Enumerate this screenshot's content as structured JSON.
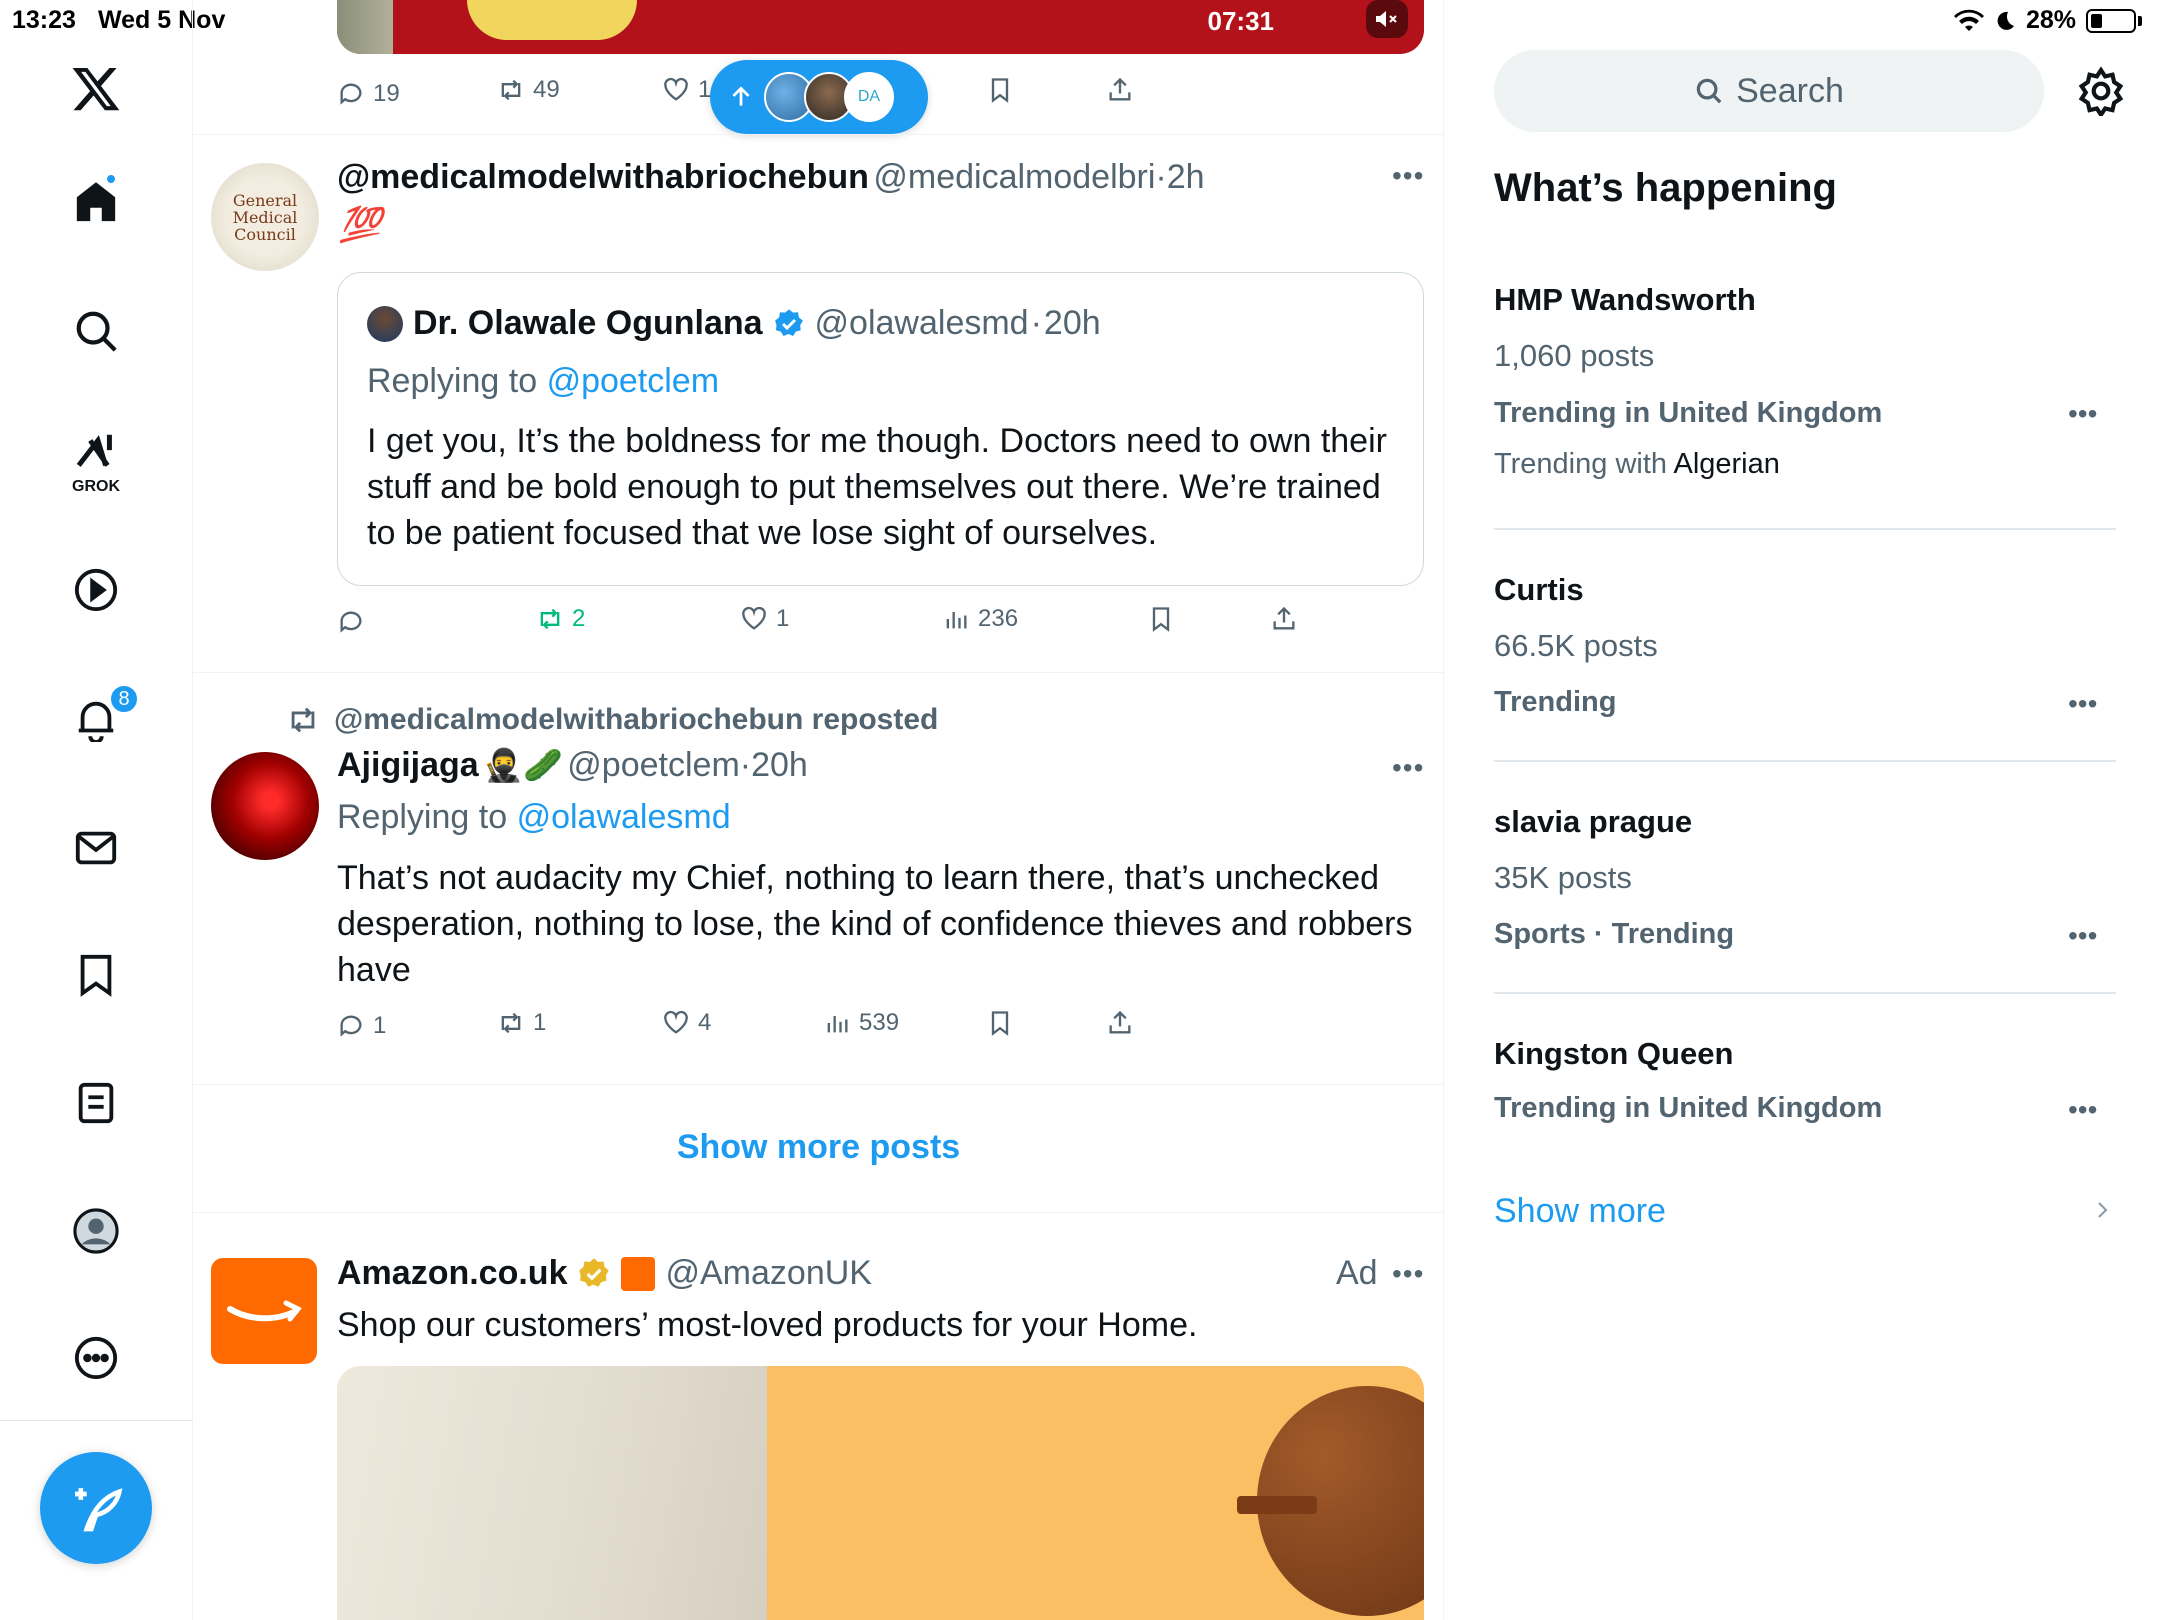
{
  "status": {
    "time": "13:23",
    "date": "Wed 5 Nov",
    "battery": "28%"
  },
  "nav": {
    "grok_label": "GROK",
    "notifications_count": "8"
  },
  "top_post": {
    "video_time": "07:31",
    "replies": "19",
    "reposts": "49",
    "likes": "1"
  },
  "post1": {
    "name": "@medicalmodelwithabriochebun",
    "handle": "@medicalmodelbri",
    "sep": "·",
    "time": "2h",
    "emoji": "💯",
    "avatar_text": "General Medical Council",
    "quote": {
      "name": "Dr. Olawale Ogunlana",
      "handle": "@olawalesmd",
      "sep": "·",
      "time": "20h",
      "replying_prefix": "Replying to",
      "replying_to": "@poetclem",
      "text": "I get you, It’s the boldness for me though. Doctors need to own their stuff and be bold enough to put themselves out there. We’re trained to be patient focused that we lose sight of ourselves."
    },
    "reposts": "2",
    "likes": "1",
    "views": "236"
  },
  "post2": {
    "repost_label": "@medicalmodelwithabriochebun reposted",
    "name": "Ajigijaga",
    "name_emoji": "🥷🥒",
    "handle": "@poetclem",
    "sep": "·",
    "time": "20h",
    "replying_prefix": "Replying to",
    "replying_to": "@olawalesmd",
    "text": "That’s not audacity my Chief, nothing to learn there, that’s unchecked desperation, nothing to lose, the kind of confidence thieves and robbers have",
    "replies": "1",
    "reposts": "1",
    "likes": "4",
    "views": "539"
  },
  "show_more_posts": "Show more posts",
  "ad": {
    "name": "Amazon.co.uk",
    "handle": "@AmazonUK",
    "ad_label": "Ad",
    "text": "Shop our customers’ most-loved products for your Home."
  },
  "sidebar": {
    "search_placeholder": "Search",
    "heading": "What’s happening",
    "show_more": "Show more",
    "trends": [
      {
        "title": "HMP Wandsworth",
        "count": "1,060 posts",
        "meta": "Trending in United Kingdom",
        "with_prefix": "Trending with",
        "with_topic": "Algerian"
      },
      {
        "title": "Curtis",
        "count": "66.5K posts",
        "meta": "Trending"
      },
      {
        "title": "slavia prague",
        "count": "35K posts",
        "meta": "Sports · Trending"
      },
      {
        "title": "Kingston Queen",
        "meta": "Trending in United Kingdom"
      }
    ]
  },
  "colors": {
    "accent": "#1d9bf0",
    "repost_green": "#00ba7c",
    "muted": "#536471",
    "amazon_orange": "#ff6a00"
  }
}
